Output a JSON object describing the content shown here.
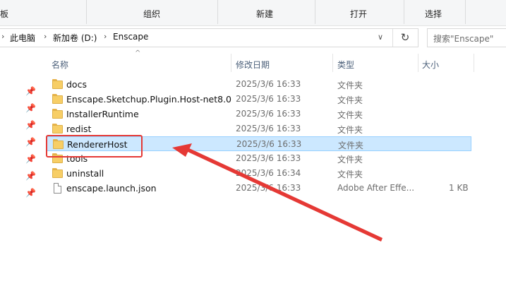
{
  "ribbon": {
    "groups": [
      "板",
      "组织",
      "新建",
      "打开",
      "选择"
    ]
  },
  "address": {
    "crumbs": [
      "此电脑",
      "新加卷 (D:)",
      "Enscape"
    ]
  },
  "search": {
    "placeholder": "搜索\"Enscape\""
  },
  "columns": {
    "name": "名称",
    "date": "修改日期",
    "type": "类型",
    "size": "大小"
  },
  "files": [
    {
      "name": "docs",
      "date": "2025/3/6 16:33",
      "type": "文件夹",
      "size": "",
      "kind": "folder"
    },
    {
      "name": "Enscape.Sketchup.Plugin.Host-net8.0",
      "date": "2025/3/6 16:33",
      "type": "文件夹",
      "size": "",
      "kind": "folder"
    },
    {
      "name": "InstallerRuntime",
      "date": "2025/3/6 16:33",
      "type": "文件夹",
      "size": "",
      "kind": "folder"
    },
    {
      "name": "redist",
      "date": "2025/3/6 16:33",
      "type": "文件夹",
      "size": "",
      "kind": "folder"
    },
    {
      "name": "RendererHost",
      "date": "2025/3/6 16:33",
      "type": "文件夹",
      "size": "",
      "kind": "folder",
      "selected": true
    },
    {
      "name": "tools",
      "date": "2025/3/6 16:33",
      "type": "文件夹",
      "size": "",
      "kind": "folder"
    },
    {
      "name": "uninstall",
      "date": "2025/3/6 16:34",
      "type": "文件夹",
      "size": "",
      "kind": "folder"
    },
    {
      "name": "enscape.launch.json",
      "date": "2025/3/6 16:33",
      "type": "Adobe After Effe...",
      "size": "1 KB",
      "kind": "file"
    }
  ],
  "colors": {
    "selection": "#cce8ff",
    "annotation": "#e53935",
    "folder": "#f7ce66"
  }
}
